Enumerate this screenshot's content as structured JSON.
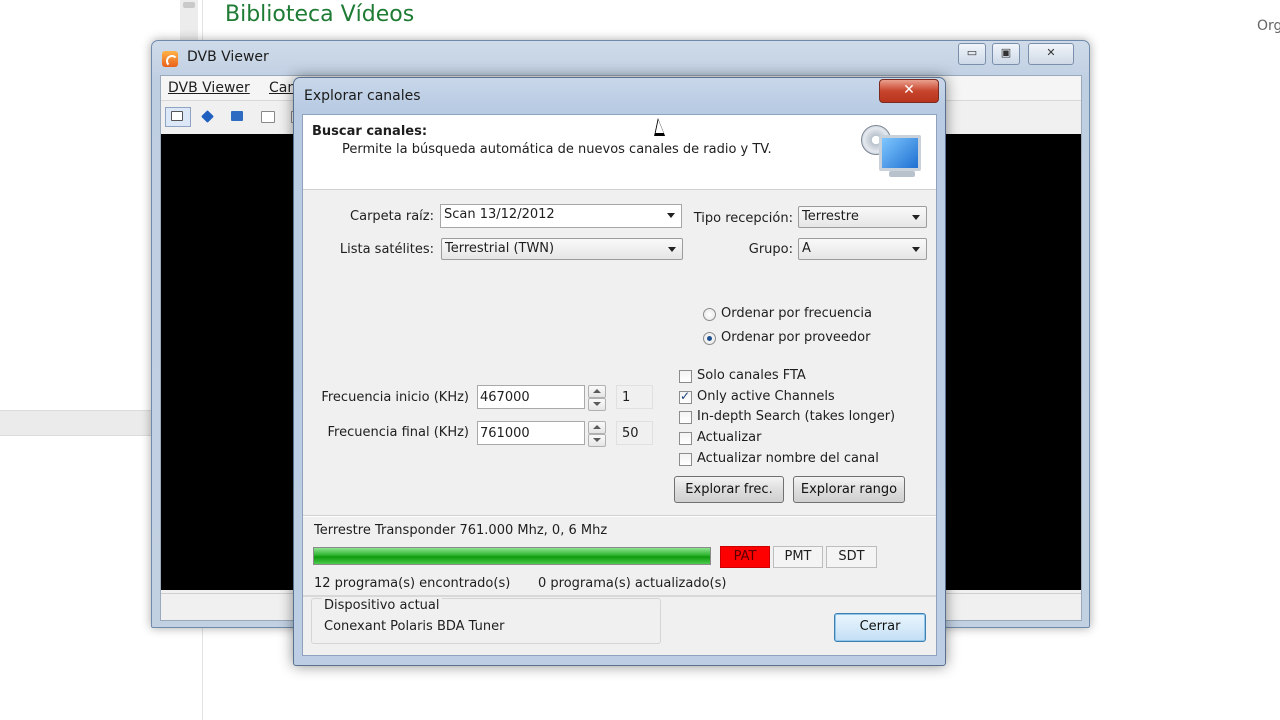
{
  "background": {
    "title": "Biblioteca Vídeos",
    "subtitle": "",
    "org_label": "Org"
  },
  "dvb_viewer": {
    "title": "DVB Viewer",
    "menu": [
      "DVB Viewer",
      "Can"
    ],
    "caption_buttons": {
      "minimize": "▭",
      "maximize": "▣",
      "close": "✕"
    }
  },
  "dialog": {
    "title": "Explorar canales",
    "close_glyph": "✕",
    "header": {
      "title": "Buscar canales:",
      "description": "Permite la búsqueda automática de nuevos canales de radio y TV."
    },
    "fields": {
      "carpeta_raiz": {
        "label": "Carpeta raíz:",
        "value": "Scan 13/12/2012"
      },
      "lista_satelites": {
        "label": "Lista satélites:",
        "value": "Terrestrial (TWN)"
      },
      "tipo_recepcion": {
        "label": "Tipo recepción:",
        "value": "Terrestre"
      },
      "grupo": {
        "label": "Grupo:",
        "value": "A"
      }
    },
    "sort_options": [
      {
        "label": "Ordenar por frecuencia",
        "selected": false
      },
      {
        "label": "Ordenar por proveedor",
        "selected": true
      }
    ],
    "frequency": {
      "start": {
        "label": "Frecuencia inicio (KHz)",
        "value": "467000",
        "step": "1"
      },
      "end": {
        "label": "Frecuencia final (KHz)",
        "value": "761000",
        "step": "50"
      }
    },
    "checkboxes": [
      {
        "label": "Solo canales FTA",
        "checked": false
      },
      {
        "label": "Only active Channels",
        "checked": true
      },
      {
        "label": "In-depth Search (takes longer)",
        "checked": false
      },
      {
        "label": "Actualizar",
        "checked": false
      },
      {
        "label": "Actualizar nombre del canal",
        "checked": false
      }
    ],
    "buttons": {
      "explorar_frec": "Explorar frec.",
      "explorar_rango": "Explorar rango",
      "cerrar": "Cerrar"
    },
    "status": {
      "transponder": "Terrestre Transponder 761.000 Mhz, 0, 6 Mhz",
      "progress": 1.0,
      "tables": [
        {
          "label": "PAT",
          "active": true,
          "color": "#ff0000"
        },
        {
          "label": "PMT",
          "active": false
        },
        {
          "label": "SDT",
          "active": false
        }
      ],
      "found": "12 programa(s) encontrado(s)",
      "updated": "0 programa(s) actualizado(s)"
    },
    "device": {
      "legend": "Dispositivo actual",
      "name": "Conexant Polaris BDA Tuner"
    }
  }
}
